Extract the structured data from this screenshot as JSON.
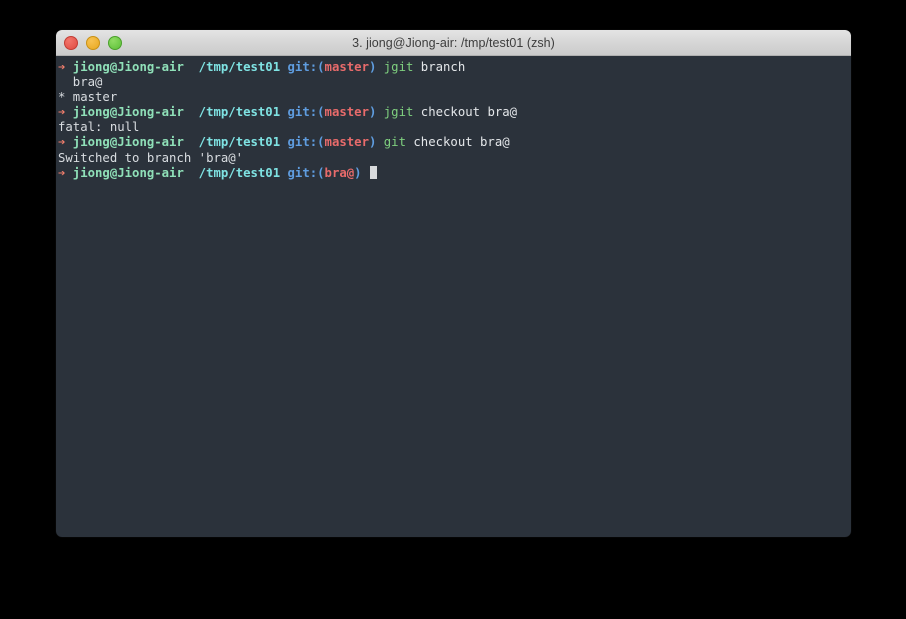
{
  "window": {
    "title": "3. jiong@Jiong-air: /tmp/test01 (zsh)",
    "controls": [
      {
        "name": "close",
        "color": "#e04b41"
      },
      {
        "name": "minimize",
        "color": "#e8a81f"
      },
      {
        "name": "maximize",
        "color": "#5cc037"
      }
    ]
  },
  "theme": {
    "desktop_background": "#000000",
    "titlebar_background": "#d6d6d6",
    "titlebar_text": "#3d3d3d",
    "terminal_background": "#2b323b",
    "prompt_arrow": "#f47f6c",
    "prompt_user": "#8fe0b8",
    "prompt_path": "#7fe3e3",
    "prompt_git_label": "#5f9de0",
    "prompt_branch": "#e86b6b",
    "command": "#7fd07f",
    "argument": "#e4e7ea",
    "output": "#d9dde1",
    "cursor": "#d8dadc"
  },
  "shell": {
    "arrow_glyph": "➔",
    "user_host": "jiong@Jiong-air",
    "path": "/tmp/test01",
    "git_prefix": "git:(",
    "git_suffix": ")"
  },
  "session": {
    "lines": [
      {
        "type": "prompt",
        "branch": "master",
        "command": "jgit",
        "args": "branch"
      },
      {
        "type": "output",
        "text": "  bra@"
      },
      {
        "type": "output",
        "text": "* master"
      },
      {
        "type": "prompt",
        "branch": "master",
        "command": "jgit",
        "args": "checkout bra@"
      },
      {
        "type": "output",
        "text": "fatal: null"
      },
      {
        "type": "prompt",
        "branch": "master",
        "command": "git",
        "args": "checkout bra@"
      },
      {
        "type": "output",
        "text": "Switched to branch 'bra@'"
      },
      {
        "type": "prompt",
        "branch": "bra@",
        "command": "",
        "args": "",
        "cursor": true
      }
    ]
  }
}
